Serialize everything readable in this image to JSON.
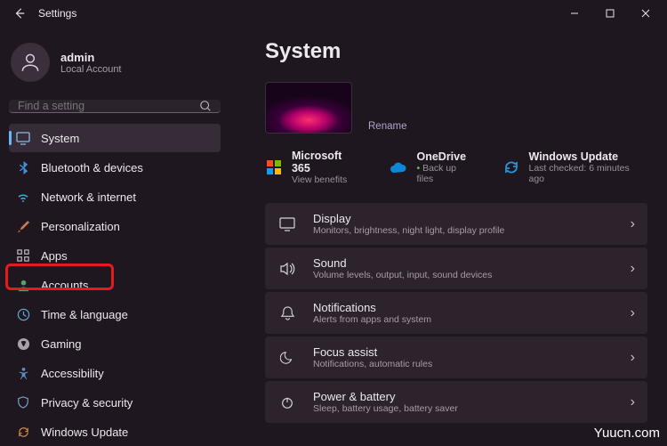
{
  "app_title": "Settings",
  "user": {
    "name": "admin",
    "sub": "Local Account"
  },
  "search": {
    "placeholder": "Find a setting"
  },
  "nav": [
    {
      "label": "System"
    },
    {
      "label": "Bluetooth & devices"
    },
    {
      "label": "Network & internet"
    },
    {
      "label": "Personalization"
    },
    {
      "label": "Apps"
    },
    {
      "label": "Accounts"
    },
    {
      "label": "Time & language"
    },
    {
      "label": "Gaming"
    },
    {
      "label": "Accessibility"
    },
    {
      "label": "Privacy & security"
    },
    {
      "label": "Windows Update"
    }
  ],
  "page": {
    "title": "System",
    "rename": "Rename"
  },
  "services": [
    {
      "title": "Microsoft 365",
      "sub": "View benefits"
    },
    {
      "title": "OneDrive",
      "sub": "Back up files"
    },
    {
      "title": "Windows Update",
      "sub": "Last checked: 6 minutes ago"
    }
  ],
  "items": [
    {
      "title": "Display",
      "sub": "Monitors, brightness, night light, display profile"
    },
    {
      "title": "Sound",
      "sub": "Volume levels, output, input, sound devices"
    },
    {
      "title": "Notifications",
      "sub": "Alerts from apps and system"
    },
    {
      "title": "Focus assist",
      "sub": "Notifications, automatic rules"
    },
    {
      "title": "Power & battery",
      "sub": "Sleep, battery usage, battery saver"
    }
  ],
  "watermark": "Yuucn.com"
}
